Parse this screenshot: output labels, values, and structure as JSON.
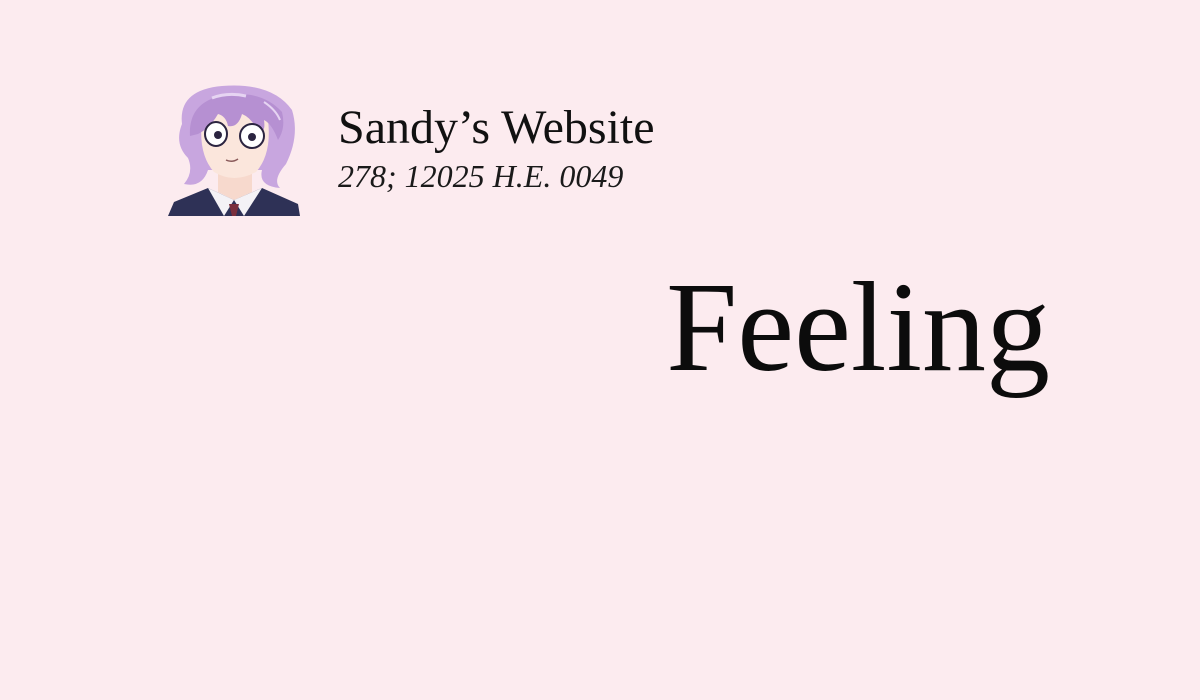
{
  "site": {
    "title": "Sandy’s Website",
    "date": "278; 12025 H.E. 0049"
  },
  "main": {
    "headline": "Feeling"
  },
  "colors": {
    "background": "#fcebef",
    "text": "#111111",
    "hair": "#c8a6df",
    "jacket": "#2e3156"
  },
  "icons": {
    "avatar": "anime-character-avatar"
  }
}
